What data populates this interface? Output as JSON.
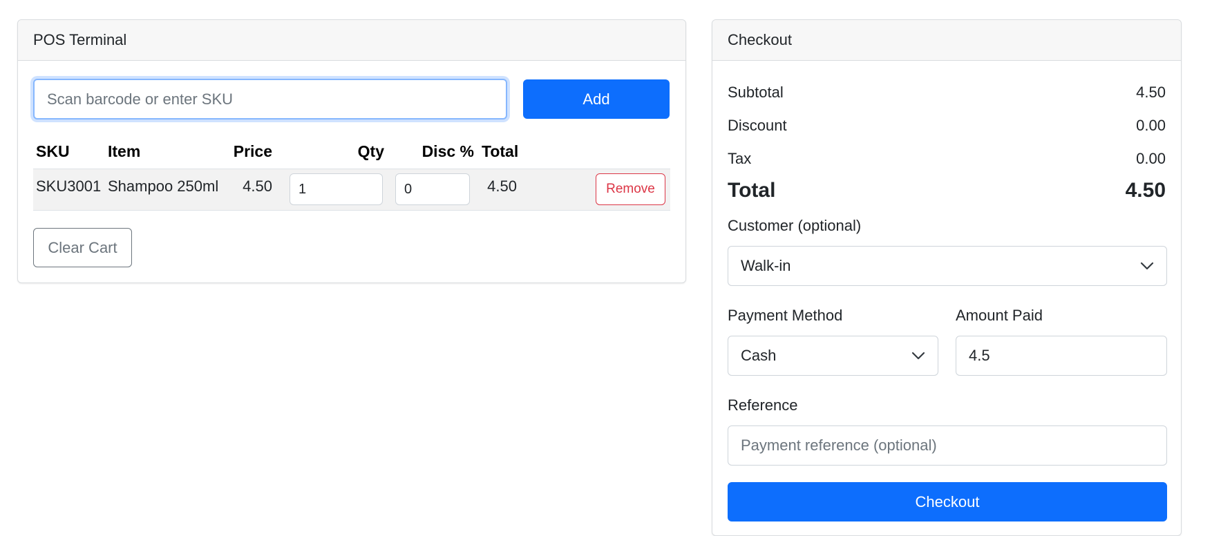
{
  "pos": {
    "title": "POS Terminal",
    "search_placeholder": "Scan barcode or enter SKU",
    "add_label": "Add",
    "columns": [
      "SKU",
      "Item",
      "Price",
      "Qty",
      "Disc %",
      "Total"
    ],
    "rows": [
      {
        "sku": "SKU3001",
        "item": "Shampoo 250ml",
        "price": "4.50",
        "qty": "1",
        "disc": "0",
        "total": "4.50",
        "remove_label": "Remove"
      }
    ],
    "clear_cart_label": "Clear Cart"
  },
  "checkout": {
    "title": "Checkout",
    "subtotal_label": "Subtotal",
    "subtotal": "4.50",
    "discount_label": "Discount",
    "discount": "0.00",
    "tax_label": "Tax",
    "tax": "0.00",
    "total_label": "Total",
    "total": "4.50",
    "customer_label": "Customer (optional)",
    "customer_value": "Walk-in",
    "payment_method_label": "Payment Method",
    "payment_method_value": "Cash",
    "amount_paid_label": "Amount Paid",
    "amount_paid_value": "4.5",
    "reference_label": "Reference",
    "reference_placeholder": "Payment reference (optional)",
    "checkout_label": "Checkout"
  },
  "colors": {
    "primary": "#0d6efd",
    "danger": "#dc3545",
    "secondary": "#6c757d",
    "focus_ring": "#86b7fe"
  },
  "icons": [
    "chevron-down-icon"
  ]
}
